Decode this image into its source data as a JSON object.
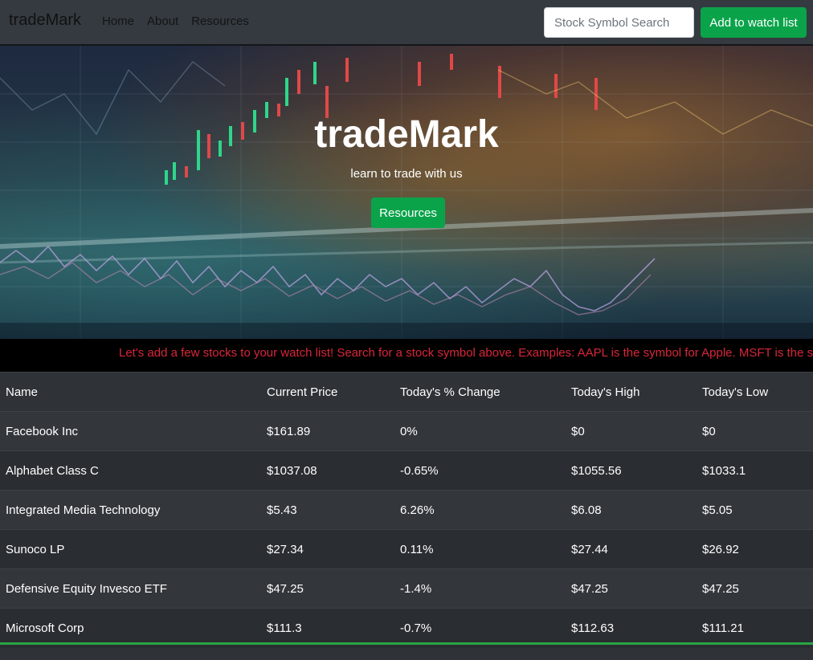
{
  "navbar": {
    "brand": "tradeMark",
    "links": [
      "Home",
      "About",
      "Resources"
    ],
    "search_placeholder": "Stock Symbol Search",
    "watch_button": "Add to watch list"
  },
  "hero": {
    "title": "tradeMark",
    "subtitle": "learn to trade with us",
    "button": "Resources"
  },
  "ticker": {
    "text": "Let's add a few stocks to your watch list! Search for a stock symbol above. Examples: AAPL is the symbol for Apple. MSFT is the symbol f"
  },
  "table": {
    "headers": [
      "Name",
      "Current Price",
      "Today's % Change",
      "Today's High",
      "Today's Low"
    ],
    "rows": [
      [
        "Facebook Inc",
        "$161.89",
        "0%",
        "$0",
        "$0"
      ],
      [
        "Alphabet Class C",
        "$1037.08",
        "-0.65%",
        "$1055.56",
        "$1033.1"
      ],
      [
        "Integrated Media Technology",
        "$5.43",
        "6.26%",
        "$6.08",
        "$5.05"
      ],
      [
        "Sunoco LP",
        "$27.34",
        "0.11%",
        "$27.44",
        "$26.92"
      ],
      [
        "Defensive Equity Invesco ETF",
        "$47.25",
        "-1.4%",
        "$47.25",
        "$47.25"
      ],
      [
        "Microsoft Corp",
        "$111.3",
        "-0.7%",
        "$112.63",
        "$111.21"
      ]
    ]
  },
  "colors": {
    "accent_green": "#0aa34a",
    "ticker_red": "#d9263a",
    "navbar_bg": "#343a40"
  }
}
